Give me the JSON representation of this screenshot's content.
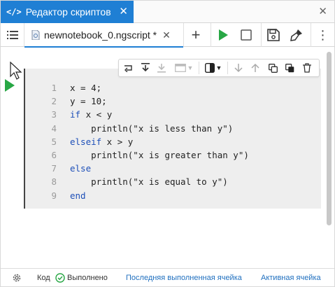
{
  "panel": {
    "title": "Редактор скриптов"
  },
  "document": {
    "tab_label": "newnotebook_0.ngscript *"
  },
  "toolbar": {
    "add": "+",
    "more": "⋮"
  },
  "code_lines": [
    {
      "num": "1",
      "text": "x = 4;"
    },
    {
      "num": "2",
      "text": "y = 10;"
    },
    {
      "num": "3",
      "kw": "if",
      "rest": " x < y"
    },
    {
      "num": "4",
      "text": "    println(\"x is less than y\")"
    },
    {
      "num": "5",
      "kw": "elseif",
      "rest": " x > y"
    },
    {
      "num": "6",
      "text": "    println(\"x is greater than y\")"
    },
    {
      "num": "7",
      "kw": "else",
      "rest": ""
    },
    {
      "num": "8",
      "text": "    println(\"x is equal to y\")"
    },
    {
      "num": "9",
      "kw": "end",
      "rest": ""
    }
  ],
  "statusbar": {
    "kind": "Код",
    "status": "Выполнено",
    "last_cell": "Последняя выполненная ячейка",
    "active_cell": "Активная ячейка"
  },
  "colors": {
    "accent": "#1f7fd4",
    "run": "#28a745",
    "keyword": "#1d4fb8",
    "link": "#1f6fbf"
  }
}
